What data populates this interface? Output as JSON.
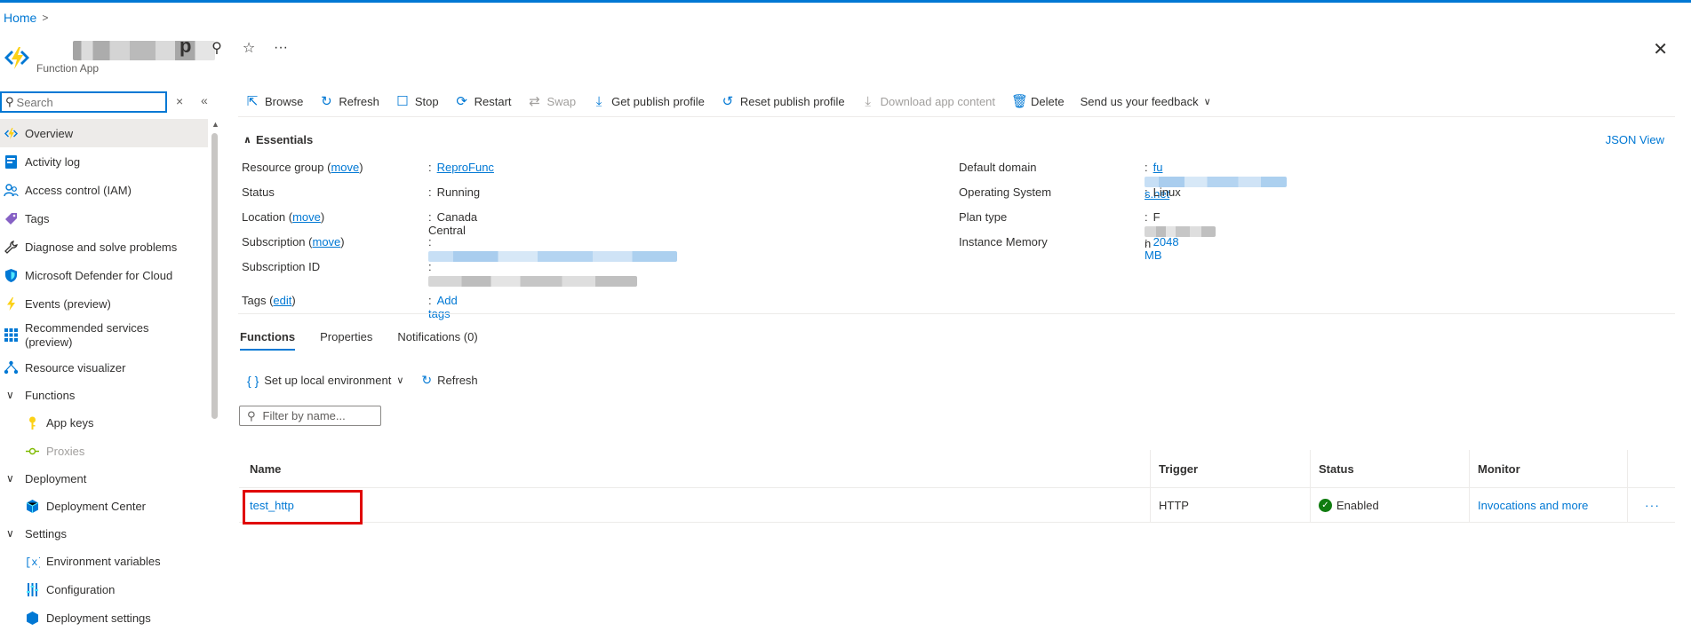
{
  "breadcrumb": {
    "home": "Home",
    "sep": ">"
  },
  "header": {
    "app_name_tail": "p",
    "subtitle": "Function App",
    "pin": "⚲",
    "star": "☆",
    "more": "···",
    "close": "✕"
  },
  "sidebar": {
    "search_placeholder": "Search",
    "clear": "×",
    "collapse": "«",
    "items": [
      {
        "label": "Overview"
      },
      {
        "label": "Activity log"
      },
      {
        "label": "Access control (IAM)"
      },
      {
        "label": "Tags"
      },
      {
        "label": "Diagnose and solve problems"
      },
      {
        "label": "Microsoft Defender for Cloud"
      },
      {
        "label": "Events (preview)"
      },
      {
        "label": "Recommended services (preview)"
      },
      {
        "label": "Resource visualizer"
      },
      {
        "label": "Functions"
      },
      {
        "label": "App keys"
      },
      {
        "label": "Proxies"
      },
      {
        "label": "Deployment"
      },
      {
        "label": "Deployment Center"
      },
      {
        "label": "Settings"
      },
      {
        "label": "Environment variables"
      },
      {
        "label": "Configuration"
      },
      {
        "label": "Deployment settings"
      }
    ]
  },
  "toolbar": {
    "browse": "Browse",
    "refresh": "Refresh",
    "stop": "Stop",
    "restart": "Restart",
    "swap": "Swap",
    "get_publish_profile": "Get publish profile",
    "reset_publish_profile": "Reset publish profile",
    "download_app_content": "Download app content",
    "delete": "Delete",
    "feedback": "Send us your feedback"
  },
  "essentials": {
    "title": "Essentials",
    "json_view": "JSON View",
    "left": {
      "resource_group_label": "Resource group (",
      "move": "move",
      "close_paren": ")",
      "resource_group_value": "ReproFunc",
      "status_label": "Status",
      "status_value": "Running",
      "location_label": "Location (",
      "location_value": "Canada Central",
      "subscription_label": "Subscription (",
      "subscription_id_label": "Subscription ID",
      "tags_label": "Tags (",
      "edit": "edit",
      "tags_value": "Add tags"
    },
    "right": {
      "default_domain_label": "Default domain",
      "default_domain_start": "fu",
      "default_domain_end": "s.net",
      "os_label": "Operating System",
      "os_value": "Linux",
      "plan_label": "Plan type",
      "plan_start": "F",
      "plan_end": "n",
      "memory_label": "Instance Memory",
      "memory_value": "2048 MB"
    },
    "colon": ":"
  },
  "tabs": [
    {
      "label": "Functions"
    },
    {
      "label": "Properties"
    },
    {
      "label": "Notifications (0)"
    }
  ],
  "functions": {
    "setup_local": "Set up local environment",
    "refresh": "Refresh",
    "filter_placeholder": "Filter by name...",
    "columns": [
      "Name",
      "Trigger",
      "Status",
      "Monitor"
    ],
    "rows": [
      {
        "name": "test_http",
        "trigger": "HTTP",
        "status": "Enabled",
        "monitor": "Invocations and more",
        "more": "···"
      }
    ]
  }
}
